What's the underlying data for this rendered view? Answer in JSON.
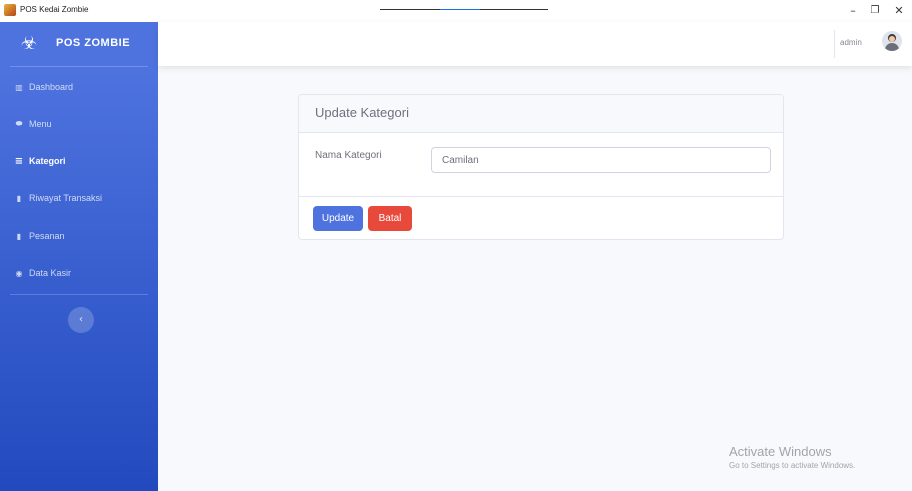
{
  "window": {
    "title": "POS Kedai Zombie",
    "minimize_icon": "–",
    "maximize_icon": "❐",
    "close_icon": "✕"
  },
  "sidebar": {
    "brand": "POS ZOMBIE",
    "brand_icon": "☣",
    "items": [
      {
        "label": "Dashboard",
        "icon": "▥",
        "active": false
      },
      {
        "label": "Menu",
        "icon": "⬬",
        "active": false
      },
      {
        "label": "Kategori",
        "icon": "≡",
        "active": true
      },
      {
        "label": "Riwayat Transaksi",
        "icon": "▮",
        "active": false
      },
      {
        "label": "Pesanan",
        "icon": "▮",
        "active": false
      },
      {
        "label": "Data Kasir",
        "icon": "◉",
        "active": false
      }
    ],
    "toggle_icon": "‹"
  },
  "topbar": {
    "user_name": "admin"
  },
  "form": {
    "title": "Update Kategori",
    "field_label": "Nama Kategori",
    "field_value": "Camilan",
    "update_label": "Update",
    "batal_label": "Batal"
  },
  "watermark": {
    "title": "Activate Windows",
    "subtitle": "Go to Settings to activate Windows."
  },
  "colors": {
    "sidebar_top": "#4e73df",
    "sidebar_bottom": "#224abe",
    "update_button": "#4e73df",
    "batal_button": "#e74a3b"
  }
}
